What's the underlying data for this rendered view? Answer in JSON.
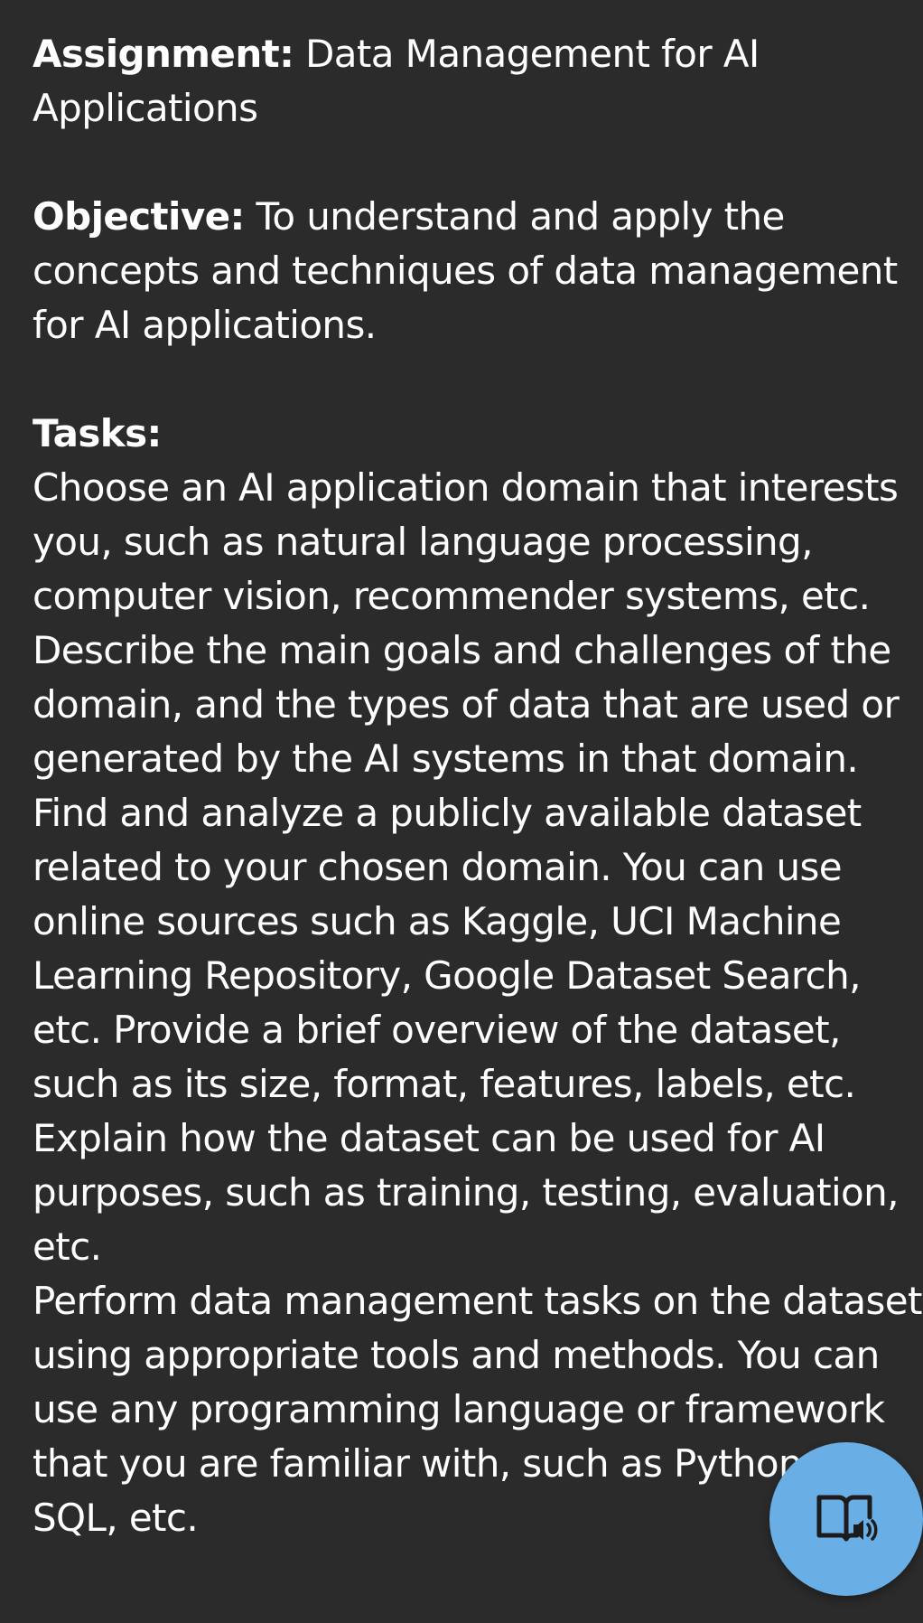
{
  "assignment": {
    "label": "Assignment:",
    "text": " Data Management for AI Applications"
  },
  "objective": {
    "label": "Objective:",
    "text": " To understand and apply the concepts and techniques of data management for AI applications."
  },
  "tasks": {
    "label": "Tasks:",
    "items": [
      "Choose an AI application domain that interests you, such as natural language processing, computer vision, recommender systems, etc. Describe the main goals and challenges of the domain, and the types of data that are used or generated by the AI systems in that domain.",
      "Find and analyze a publicly available dataset related to your chosen domain. You can use online sources such as Kaggle, UCI Machine Learning Repository, Google Dataset Search, etc. Provide a brief overview of the dataset, such as its size, format, features, labels, etc. Explain how the dataset can be used for AI purposes, such as training, testing, evaluation, etc.",
      "Perform data management tasks on the dataset using appropriate tools and methods. You can use any programming language or framework that you are familiar with, such as Python, R, SQL, etc."
    ]
  },
  "immersive_reader_button": {
    "icon": "immersive-reader-icon",
    "color": "#6aaee6"
  }
}
